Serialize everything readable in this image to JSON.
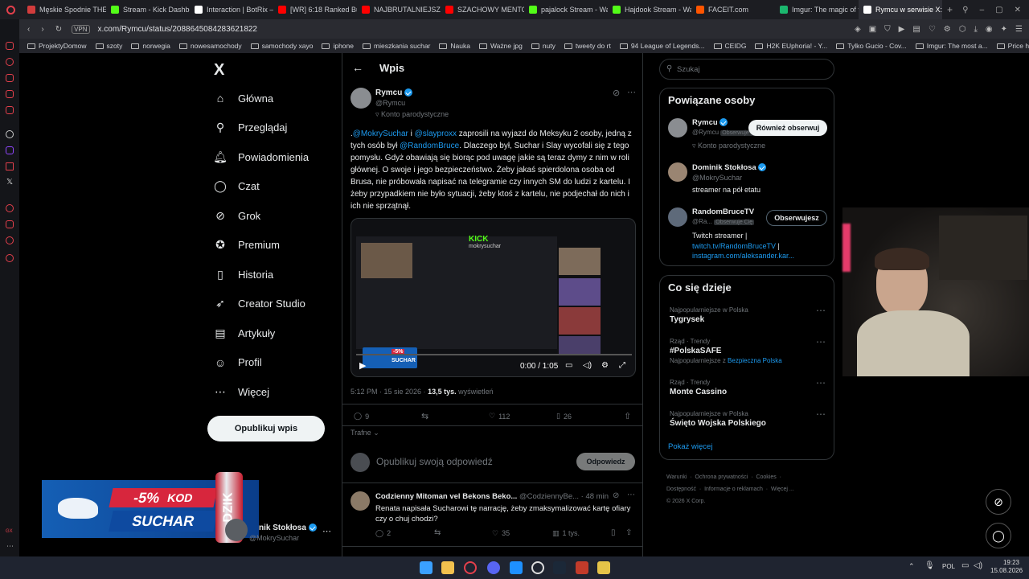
{
  "browser": {
    "tabs": [
      {
        "label": "Męskie Spodnie THE",
        "color": "#d23c3c"
      },
      {
        "label": "Stream - Kick Dashbo",
        "color": "#53fc18"
      },
      {
        "label": "Interaction | BotRix —",
        "color": "#ffffff"
      },
      {
        "label": "[WR] 6:18 Ranked Bu",
        "color": "#ff0000"
      },
      {
        "label": "NAJBRUTALNIEJSZY",
        "color": "#ff0000"
      },
      {
        "label": "SZACHOWY MENTOR",
        "color": "#ff0000"
      },
      {
        "label": "pajalock Stream - Wa",
        "color": "#53fc18"
      },
      {
        "label": "Hajdook Stream - Wa",
        "color": "#53fc18"
      },
      {
        "label": "FACEIT.com",
        "color": "#ff5500"
      },
      {
        "label": "Imgur: The magic of t",
        "color": "#1bb76e"
      },
      {
        "label": "Rymcu w serwisie X: „@M",
        "color": "#ffffff"
      }
    ],
    "url": "x.com/Rymcu/status/2088645084283621822",
    "vpn": "VPN",
    "bookmarks": [
      "ProjektyDomow",
      "szoty",
      "norwegia",
      "nowesamochody",
      "samochody xayo",
      "iphone",
      "mieszkania suchar",
      "Nauka",
      "Ważne jpg",
      "nuty",
      "tweety do rt",
      "94 League of Legends...",
      "CEIDG",
      "H2K EUphoria! - Y...",
      "Tylko Gucio - Cov...",
      "Imgur: The most a...",
      "Price history, price..."
    ]
  },
  "nav": {
    "logo": "X",
    "items": [
      {
        "label": "Główna",
        "icon": "home-icon",
        "glyph": "⌂"
      },
      {
        "label": "Przeglądaj",
        "icon": "search-icon",
        "glyph": "⚲"
      },
      {
        "label": "Powiadomienia",
        "icon": "bell-icon",
        "glyph": "🔔︎"
      },
      {
        "label": "Czat",
        "icon": "chat-icon",
        "glyph": "◯"
      },
      {
        "label": "Grok",
        "icon": "grok-icon",
        "glyph": "⊘"
      },
      {
        "label": "Premium",
        "icon": "premium-icon",
        "glyph": "✪"
      },
      {
        "label": "Historia",
        "icon": "bookmark-icon",
        "glyph": "▯"
      },
      {
        "label": "Creator Studio",
        "icon": "rocket-icon",
        "glyph": "➶"
      },
      {
        "label": "Artykuły",
        "icon": "article-icon",
        "glyph": "▤"
      },
      {
        "label": "Profil",
        "icon": "profile-icon",
        "glyph": "☺"
      },
      {
        "label": "Więcej",
        "icon": "more-icon",
        "glyph": "⋯"
      }
    ],
    "post_button": "Opublikuj wpis",
    "account_name": "nik Stokłosa",
    "account_handle": "MokrySuchar"
  },
  "main": {
    "header": "Wpis",
    "author": {
      "name": "Rymcu",
      "handle": "@Rymcu",
      "label": "Konto parodystyczne"
    },
    "tweet": {
      "mention1": "@MokrySuchar",
      "and": " i ",
      "mention2": "@slayproxx",
      "part1": " zaprosili na wyjazd do Meksyku 2 osoby, jedną z tych osób był ",
      "mention3": "@RandomBruce",
      "part2": ". Dlaczego był, Suchar i Slay wycofali się z tego pomysłu. Gdyż obawiają się biorąc pod uwagę jakie są teraz dymy z nim w roli głównej. O swoje i jego bezpieczeństwo. Żeby jakaś spierdolona osoba od Brusa, nie próbowała napisać na telegramie czy innych SM do ludzi z kartelu. I żeby przypadkiem nie było sytuacji, żeby ktoś z kartelu, nie podjechał do nich i ich nie sprzątnął."
    },
    "video": {
      "time": "0:00 / 1:05",
      "kick": "KICK",
      "kick_user": "mokrysuchar",
      "badge_percent": "-5%",
      "badge_text": "SUCHAR"
    },
    "meta": {
      "time": "5:12 PM · 15 sie 2026 · ",
      "views": "13,5 tys.",
      "views_label": " wyświetleń"
    },
    "stats": {
      "replies": "9",
      "retweets": "",
      "likes": "112",
      "bookmarks": "26"
    },
    "sort": "Trafne",
    "reply_placeholder": "Opublikuj swoją odpowiedź",
    "reply_button": "Odpowiedz",
    "reply": {
      "name": "Codzienny Mitoman vel Bekons Beko...",
      "handle": "@CodziennyBe...",
      "time": "· 48 min",
      "text": "Renata napisała Sucharowi tę narrację, żeby zmaksymalizować kartę ofiary czy o chuj chodzi?",
      "replies": "2",
      "likes": "35",
      "views": "1 tys."
    }
  },
  "right": {
    "search_placeholder": "Szukaj",
    "related_title": "Powiązane osoby",
    "people": [
      {
        "name": "Rymcu",
        "handle": "@Rymcu",
        "tag": "Obserwuje Cię",
        "bio": "Konto parodystyczne",
        "button": "Również obserwuj"
      },
      {
        "name": "Dominik Stokłosa",
        "handle": "@MokrySuchar",
        "bio": "streamer na pół etatu"
      },
      {
        "name": "RandomBruceTV",
        "handle": "@Ra...",
        "tag": "Obserwuje Cię",
        "button": "Obserwujesz",
        "bio1": "Twitch streamer |",
        "link1": "twitch.tv/RandomBruceTV",
        "sep": " |",
        "link2": "instagram.com/aleksander.kar..."
      }
    ],
    "trends_title": "Co się dzieje",
    "trends": [
      {
        "cat": "Najpopularniejsze w Polska",
        "name": "Tygrysek"
      },
      {
        "cat": "Rząd · Trendy",
        "name": "#PolskaSAFE",
        "extra_label": "Najpopularniejsze z ",
        "extra": "Bezpieczna Polska"
      },
      {
        "cat": "Rząd · Trendy",
        "name": "Monte Cassino"
      },
      {
        "cat": "Najpopularniejsze w Polska",
        "name": "Święto Wojska Polskiego"
      }
    ],
    "show_more": "Pokaż więcej",
    "footer": [
      "Warunki",
      "Ochrona prywatności",
      "Cookies",
      "Dostępność",
      "Informacje o reklamach",
      "Więcej ...",
      "© 2026 X Corp."
    ]
  },
  "ad": {
    "percent": "-5%",
    "code": "KOD",
    "name": "SUCHAR",
    "can": "DZIK"
  },
  "taskbar": {
    "lang": "POL",
    "time": "19:23",
    "date": "15.08.2026"
  }
}
